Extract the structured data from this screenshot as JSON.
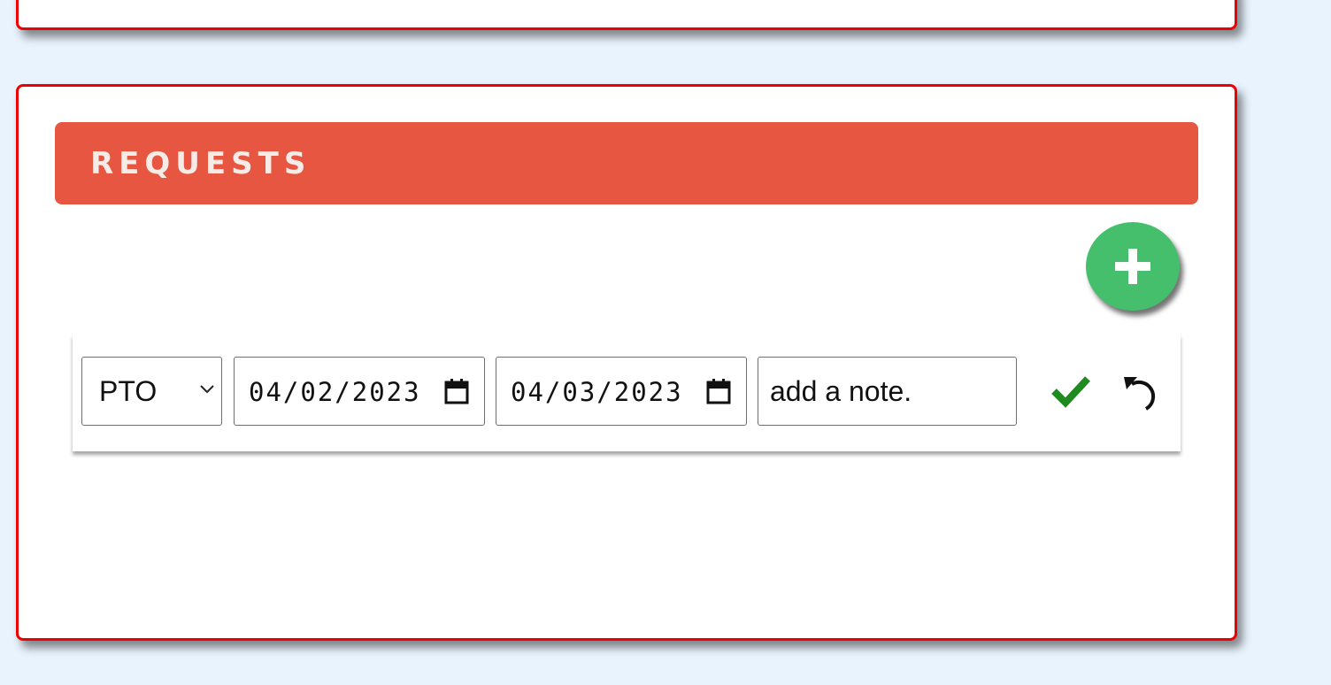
{
  "requests_section": {
    "title": "REQUESTS",
    "add_button_icon": "plus-icon"
  },
  "request_row": {
    "type": {
      "selected": "PTO"
    },
    "start_date": "04/02/2023",
    "end_date": "04/03/2023",
    "note": "add a note.",
    "confirm_icon": "checkmark-icon",
    "undo_icon": "undo-icon"
  },
  "colors": {
    "page_background": "#e9f3fd",
    "card_border": "#ee0000",
    "header_background": "#e65640",
    "header_text": "#f5ece8",
    "add_button": "#45bf6c",
    "confirm_check": "#1f8a1f"
  }
}
